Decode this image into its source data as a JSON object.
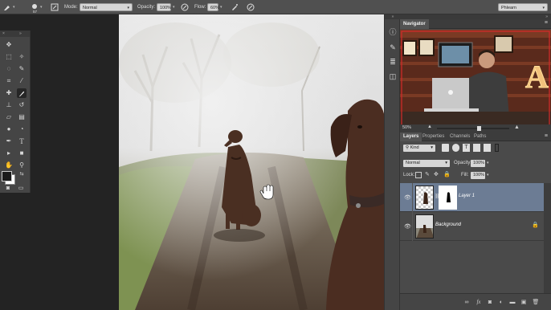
{
  "options_bar": {
    "brush_size": "57",
    "mode_label": "Mode:",
    "mode_value": "Normal",
    "opacity_label": "Opacity:",
    "opacity_value": "100%",
    "flow_label": "Flow:",
    "flow_value": "60%",
    "workspace_value": "Phlearn"
  },
  "navigator": {
    "title": "Navigator",
    "zoom_value": "50%",
    "lamp_letter": "A"
  },
  "layers_panel": {
    "tabs": [
      "Layers",
      "Properties",
      "Channels",
      "Paths"
    ],
    "kind_label": "Kind",
    "blend_mode": "Normal",
    "opacity_label": "Opacity:",
    "opacity_value": "100%",
    "lock_label": "Lock:",
    "fill_label": "Fill:",
    "fill_value": "100%",
    "layers": [
      {
        "name": "Layer 1",
        "selected": true
      },
      {
        "name": "Background",
        "selected": false
      }
    ]
  },
  "icons": {
    "tools": [
      "move-tool",
      "marquee-tool",
      "lasso-tool",
      "quick-select-tool",
      "crop-tool",
      "eyedropper-tool",
      "healing-tool",
      "brush-tool",
      "clone-stamp-tool",
      "history-brush-tool",
      "eraser-tool",
      "gradient-tool",
      "blur-tool",
      "dodge-tool",
      "pen-tool",
      "type-tool",
      "path-select-tool",
      "shape-tool",
      "hand-tool",
      "zoom-tool"
    ],
    "colors": {
      "foreground": "#1a1a1a",
      "background": "#ffffff"
    }
  },
  "colors": {
    "selected_layer": "#6c7c94",
    "panel_bg": "#4a4a4a",
    "options_bar_bg": "#505050"
  }
}
